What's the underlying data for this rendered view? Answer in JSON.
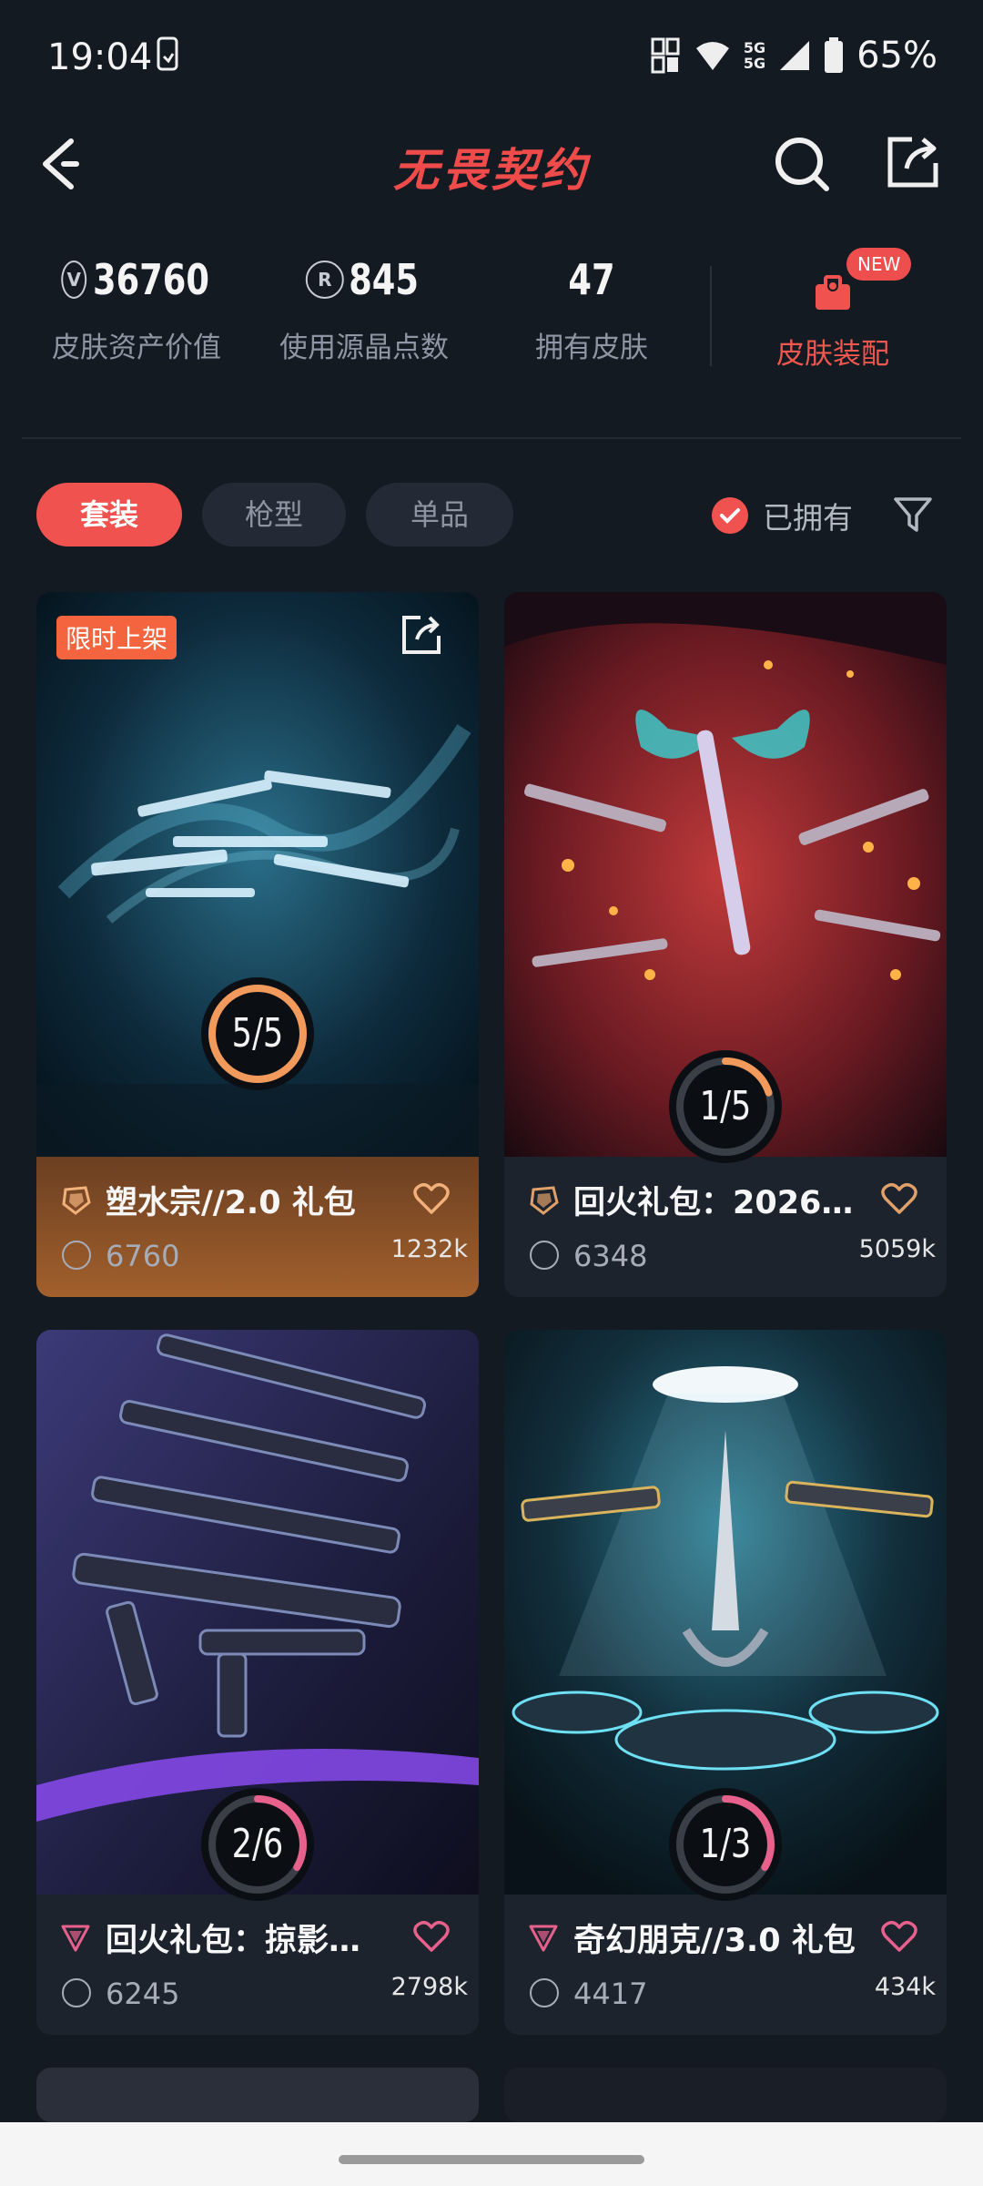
{
  "status_bar": {
    "time": "19:04",
    "battery": "65%",
    "network": "5G"
  },
  "header": {
    "title": "无畏契约"
  },
  "stats": [
    {
      "value": "36760",
      "label": "皮肤资产价值",
      "icon": "vp-coin-icon"
    },
    {
      "value": "845",
      "label": "使用源晶点数",
      "icon": "radianite-icon"
    },
    {
      "value": "47",
      "label": "拥有皮肤"
    }
  ],
  "outfit": {
    "label": "皮肤装配",
    "badge": "NEW"
  },
  "filters": {
    "tabs": [
      "套装",
      "枪型",
      "单品"
    ],
    "active": 0,
    "owned_label": "已拥有",
    "owned_checked": true
  },
  "cards": [
    {
      "name": "塑水宗//2.0 礼包",
      "price": "6760",
      "likes": "1232k",
      "progress": "5/5",
      "progress_fraction": 1.0,
      "tier_color": "#e0a06a",
      "badge": "限时上架",
      "accent": "#f29a5c"
    },
    {
      "name": "回火礼包：2026…",
      "price": "6348",
      "likes": "5059k",
      "progress": "1/5",
      "progress_fraction": 0.2,
      "tier_color": "#e0a06a",
      "accent": "#f29a5c"
    },
    {
      "name": "回火礼包：掠影…",
      "price": "6245",
      "likes": "2798k",
      "progress": "2/6",
      "progress_fraction": 0.333,
      "tier_color": "#e8608c",
      "accent": "#e8608c"
    },
    {
      "name": "奇幻朋克//3.0 礼包",
      "price": "4417",
      "likes": "434k",
      "progress": "1/3",
      "progress_fraction": 0.333,
      "tier_color": "#e8608c",
      "accent": "#e8608c"
    }
  ],
  "colors": {
    "accent": "#f0534f",
    "background": "#141a22",
    "card": "#1c232d"
  }
}
